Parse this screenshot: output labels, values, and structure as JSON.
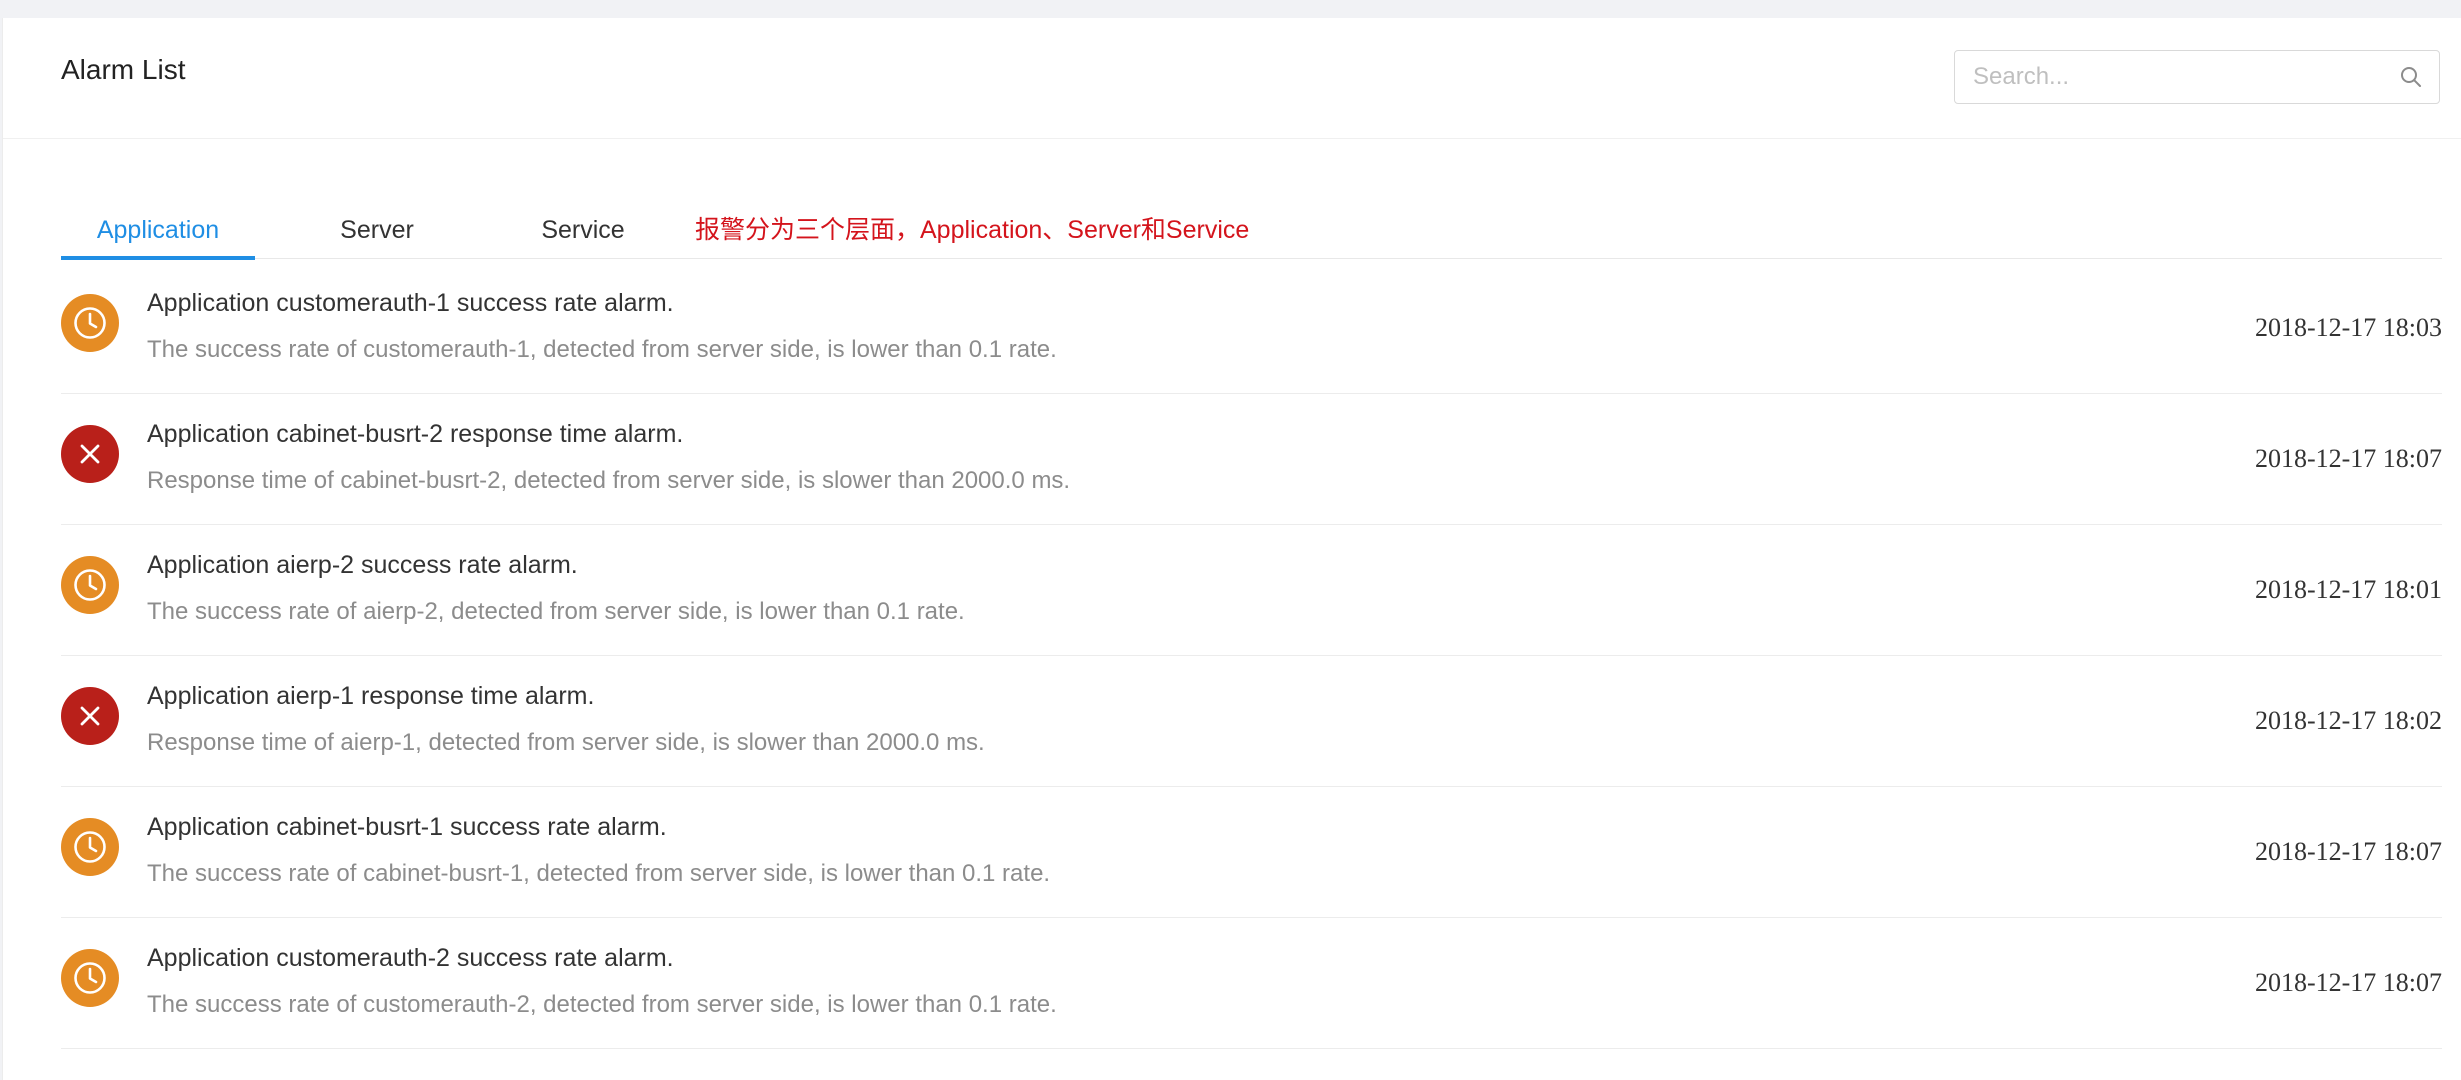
{
  "header": {
    "title": "Alarm List",
    "search": {
      "placeholder": "Search...",
      "value": ""
    }
  },
  "tabs": [
    {
      "label": "Application",
      "active": true
    },
    {
      "label": "Server",
      "active": false
    },
    {
      "label": "Service",
      "active": false
    }
  ],
  "annotation": "报警分为三个层面，Application、Server和Service",
  "colors": {
    "accent": "#1f8ee4",
    "warning": "#e58c24",
    "critical": "#b9201a",
    "annotation": "#d4141c"
  },
  "alarms": [
    {
      "icon": "clock-icon",
      "severity": "warning",
      "title": "Application customerauth-1 success rate alarm.",
      "description": "The success rate of customerauth-1, detected from server side, is lower than 0.1 rate.",
      "time": "2018-12-17 18:03"
    },
    {
      "icon": "close-icon",
      "severity": "critical",
      "title": "Application cabinet-busrt-2 response time alarm.",
      "description": "Response time of cabinet-busrt-2, detected from server side, is slower than 2000.0 ms.",
      "time": "2018-12-17 18:07"
    },
    {
      "icon": "clock-icon",
      "severity": "warning",
      "title": "Application aierp-2 success rate alarm.",
      "description": "The success rate of aierp-2, detected from server side, is lower than 0.1 rate.",
      "time": "2018-12-17 18:01"
    },
    {
      "icon": "close-icon",
      "severity": "critical",
      "title": "Application aierp-1 response time alarm.",
      "description": "Response time of aierp-1, detected from server side, is slower than 2000.0 ms.",
      "time": "2018-12-17 18:02"
    },
    {
      "icon": "clock-icon",
      "severity": "warning",
      "title": "Application cabinet-busrt-1 success rate alarm.",
      "description": "The success rate of cabinet-busrt-1, detected from server side, is lower than 0.1 rate.",
      "time": "2018-12-17 18:07"
    },
    {
      "icon": "clock-icon",
      "severity": "warning",
      "title": "Application customerauth-2 success rate alarm.",
      "description": "The success rate of customerauth-2, detected from server side, is lower than 0.1 rate.",
      "time": "2018-12-17 18:07"
    }
  ]
}
